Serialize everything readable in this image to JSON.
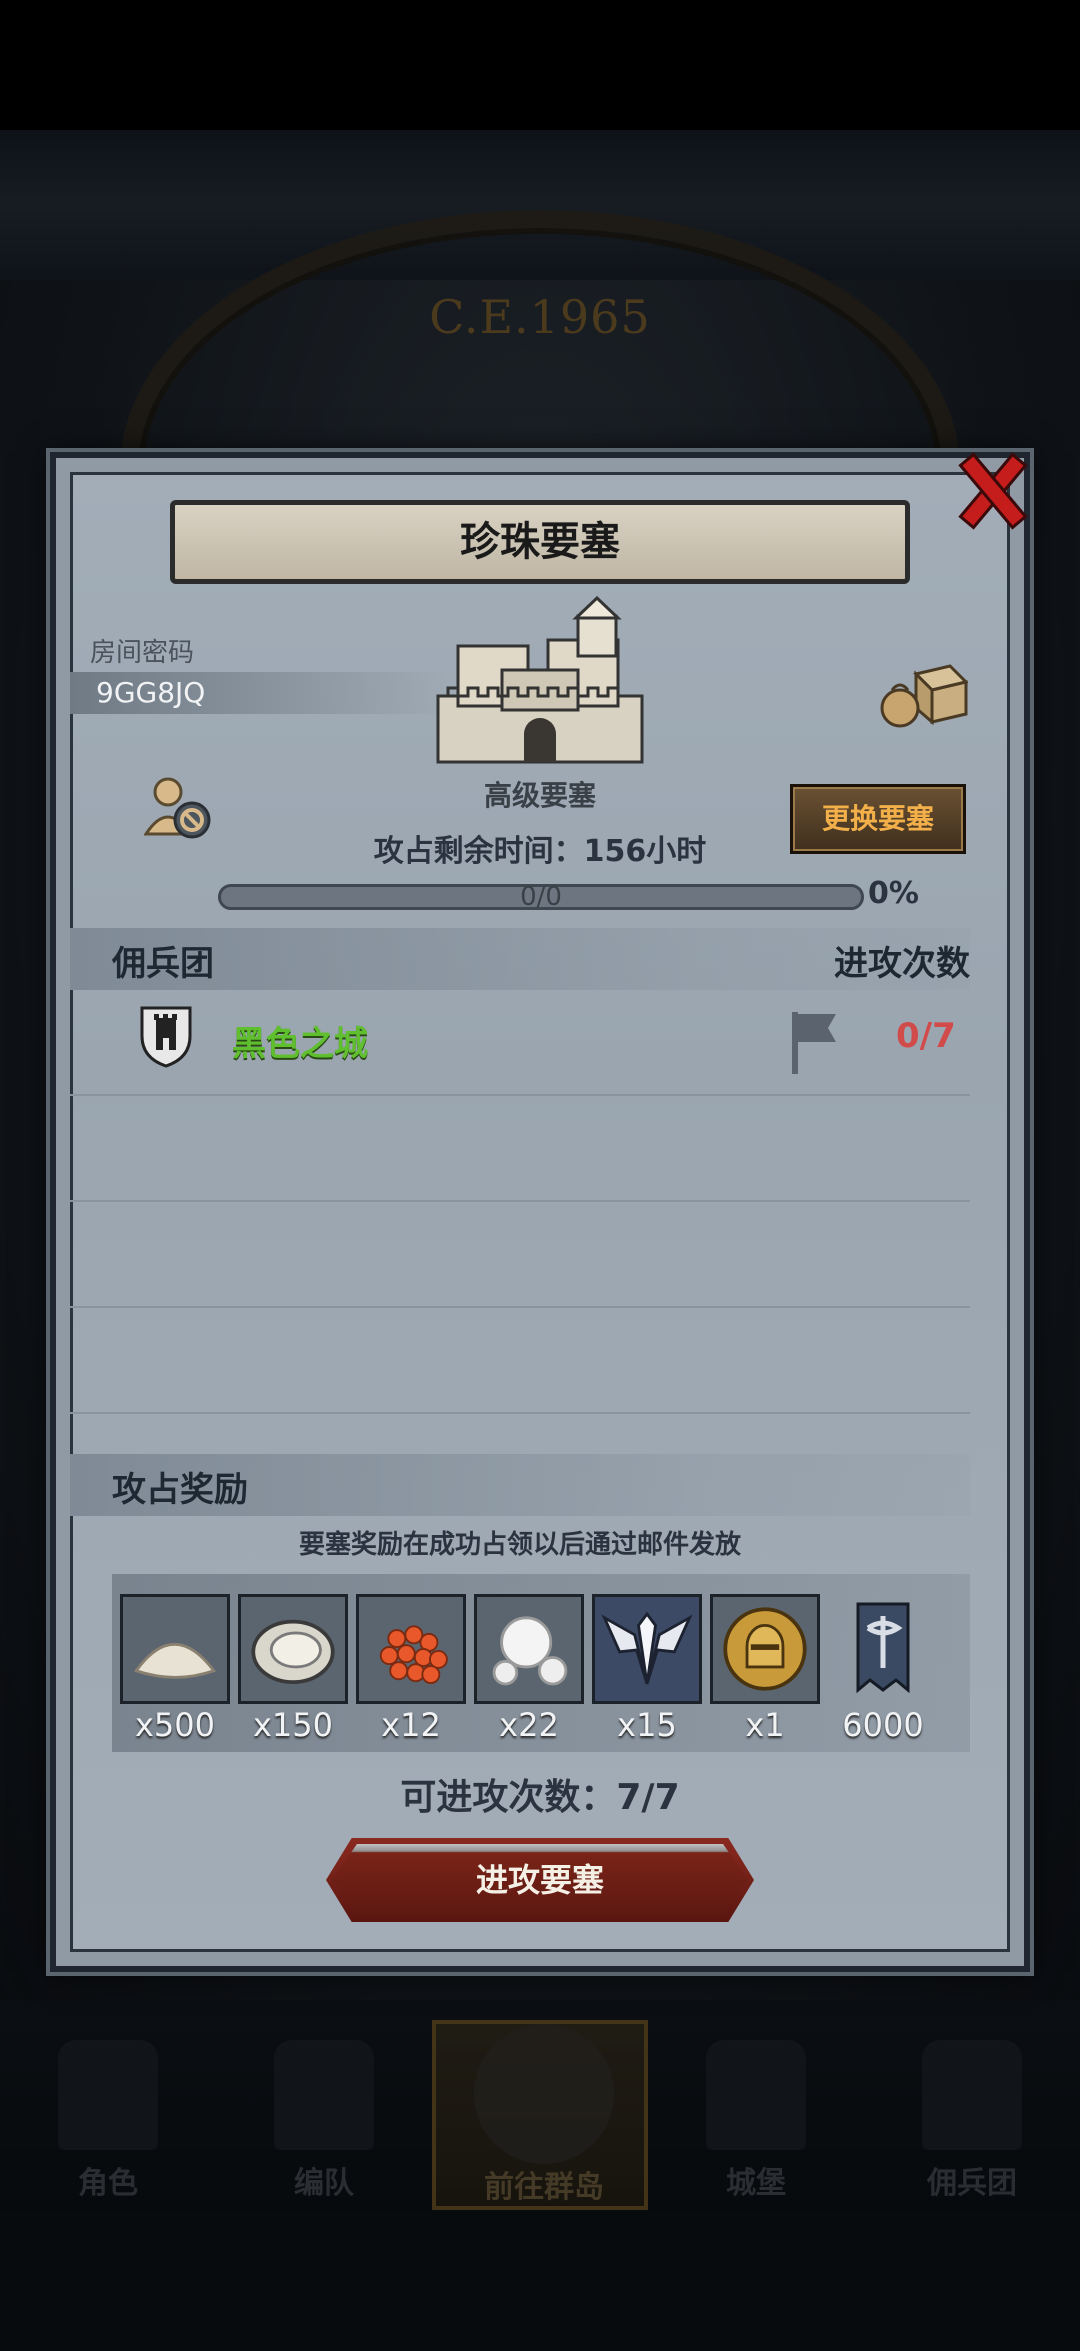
{
  "background": {
    "era": "C.E.1965"
  },
  "dialog": {
    "title": "珍珠要塞",
    "room_password_label": "房间密码",
    "room_password": "9GG8JQ",
    "fortress_grade": "高级要塞",
    "change_fortress_button": "更换要塞",
    "remaining_time": "攻占剩余时间：156小时",
    "progress": {
      "text": "0/0",
      "percent": "0%",
      "fraction": 0
    },
    "mercenary_section": {
      "title": "佣兵团",
      "attack_count_header": "进攻次数",
      "rows": [
        {
          "name": "黑色之城",
          "attack_ratio": "0/7",
          "icon": "tower-shield-icon",
          "flag": "flag-icon"
        }
      ]
    },
    "reward_section": {
      "title": "攻占奖励",
      "note": "要塞奖励在成功占领以后通过邮件发放",
      "items": [
        {
          "icon": "salt-pile-icon",
          "qty": "x500"
        },
        {
          "icon": "oyster-icon",
          "qty": "x150"
        },
        {
          "icon": "fish-roe-icon",
          "qty": "x12"
        },
        {
          "icon": "pearl-icon",
          "qty": "x22"
        },
        {
          "icon": "winged-emblem-icon",
          "qty": "x15"
        },
        {
          "icon": "knight-medal-icon",
          "qty": "x1"
        },
        {
          "icon": "banner-icon",
          "qty": "6000"
        }
      ]
    },
    "attacks_available": "可进攻次数：7/7",
    "attack_button": "进攻要塞"
  },
  "bottom_nav": [
    {
      "label": "角色"
    },
    {
      "label": "编队"
    },
    {
      "label": "前往群岛",
      "active": true
    },
    {
      "label": "城堡"
    },
    {
      "label": "佣兵团"
    }
  ],
  "colors": {
    "accent_gold": "#f3b04a",
    "merc_name_green": "#5fbf2f",
    "ratio_red": "#d24b4b",
    "close_red": "#c51c1c"
  }
}
